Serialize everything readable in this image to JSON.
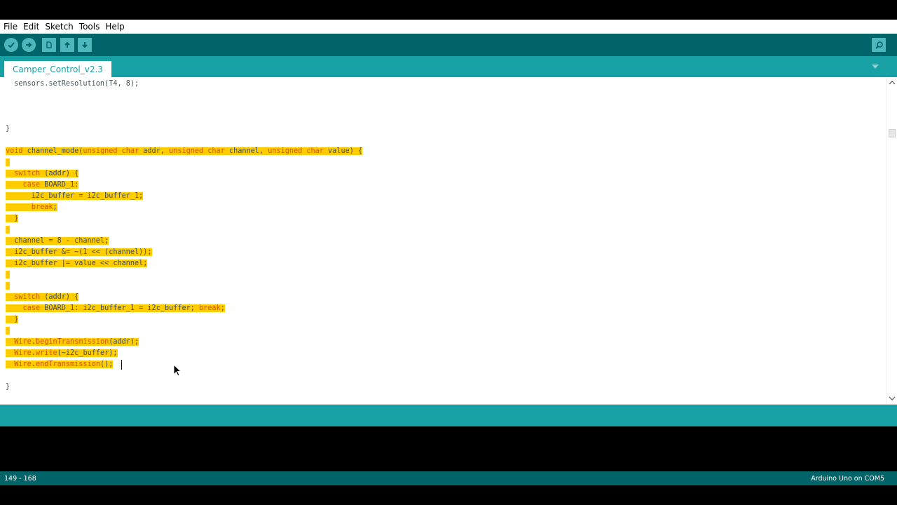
{
  "menu": [
    "File",
    "Edit",
    "Sketch",
    "Tools",
    "Help"
  ],
  "toolbar": {
    "verify": "verify-check-icon",
    "upload": "upload-arrow-icon",
    "new": "new-file-icon",
    "open": "open-arrow-up-icon",
    "save": "save-arrow-down-icon",
    "serial_monitor": "magnifier-icon"
  },
  "tabs": {
    "active": "Camper_Control_v2.3",
    "menu_icon": "triangle-down-icon"
  },
  "code": {
    "l01": "  sensors.setResolution(T4, 8);",
    "l05": "}",
    "l07a": "void",
    "l07b": " channel_mode(",
    "l07c": "unsigned char",
    "l07d": " addr, ",
    "l07e": "unsigned char",
    "l07f": " channel, ",
    "l07g": "unsigned char",
    "l07h": " value) {",
    "l09a": "  ",
    "l09b": "switch",
    "l09c": " (addr) {",
    "l10a": "    ",
    "l10b": "case",
    "l10c": " BOARD_1:",
    "l11": "      i2c_buffer = i2c_buffer_1;",
    "l12a": "      ",
    "l12b": "break",
    "l12c": ";",
    "l13": "  }",
    "l15": "  channel = 8 - channel;",
    "l16": "  i2c_buffer &= ~(1 << (channel));",
    "l17": "  i2c_buffer |= value << channel;",
    "l20a": "  ",
    "l20b": "switch",
    "l20c": " (addr) {",
    "l21a": "    ",
    "l21b": "case",
    "l21c": " BOARD_1: i2c_buffer_1 = i2c_buffer; ",
    "l21d": "break",
    "l21e": ";",
    "l22": "  }",
    "l24a": "  ",
    "l24b": "Wire",
    "l24c": ".",
    "l24d": "beginTransmission",
    "l24e": "(addr);",
    "l25a": "  ",
    "l25b": "Wire",
    "l25c": ".",
    "l25d": "write",
    "l25e": "(~i2c_buffer);",
    "l26a": "  ",
    "l26b": "Wire",
    "l26c": ".",
    "l26d": "endTransmission",
    "l26e": "();",
    "l28": "}"
  },
  "status": {
    "lines": "149 - 168",
    "board": "Arduino Uno on COM5"
  },
  "colors": {
    "toolbar": "#006468",
    "tabbar": "#17a1a5",
    "highlight": "#ffcc00",
    "keyword": "#d35400"
  }
}
